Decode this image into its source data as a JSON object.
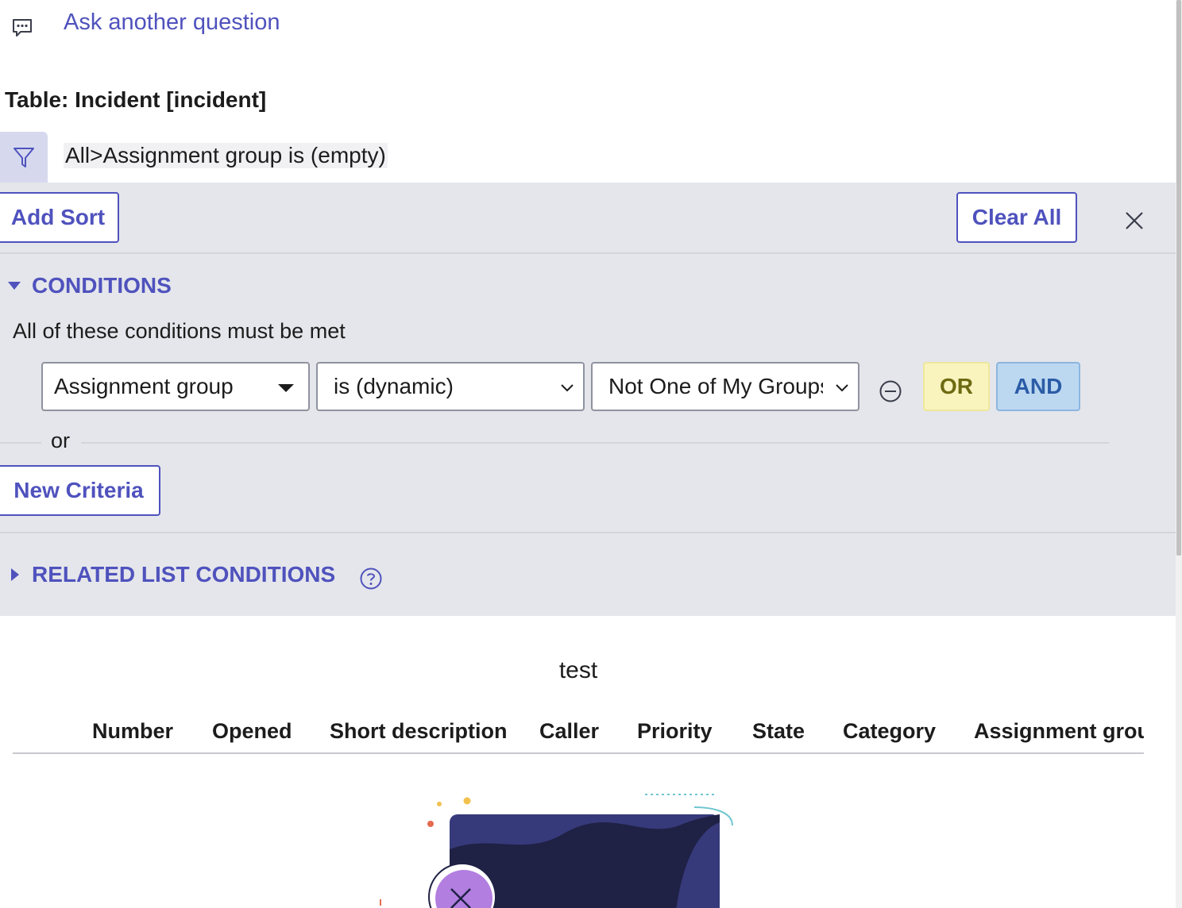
{
  "ask": {
    "link": "Ask another question",
    "icon": "chat-bubble-icon"
  },
  "table_label": "Table: Incident [incident]",
  "filter": {
    "icon": "filter-icon",
    "breadcrumb": "All>Assignment group is (empty)"
  },
  "toolbar": {
    "add_sort": "Add Sort",
    "clear_all": "Clear All",
    "close_icon": "close-icon"
  },
  "conditions": {
    "header": "CONDITIONS",
    "subtitle": "All of these conditions must be met",
    "row": {
      "field": "Assignment group",
      "operator": "is (dynamic)",
      "value": "Not One of My Groups"
    },
    "or_button": "OR",
    "and_button": "AND",
    "or_separator": "or",
    "new_criteria": "New Criteria"
  },
  "related": {
    "header": "RELATED LIST CONDITIONS",
    "help_icon": "help-circle-icon"
  },
  "list": {
    "title": "test",
    "columns": [
      "Number",
      "Opened",
      "Short description",
      "Caller",
      "Priority",
      "State",
      "Category",
      "Assignment group"
    ]
  },
  "colors": {
    "accent": "#4f52bd",
    "panel": "#e4e6eb",
    "or_bg": "#f9f4be",
    "and_bg": "#bcd8f1"
  }
}
